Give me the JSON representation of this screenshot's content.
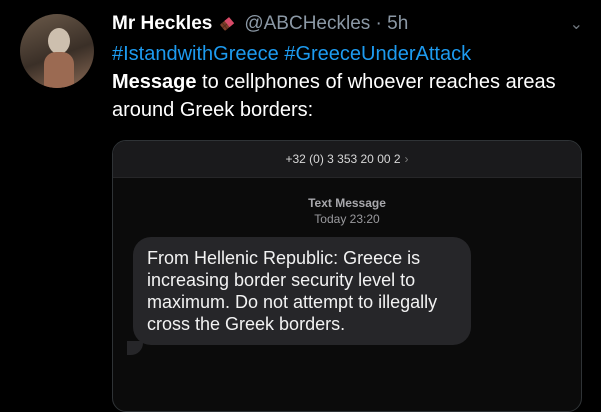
{
  "tweet": {
    "author_name": "Mr Heckles",
    "handle_and_time": "@ABCHeckles · 5h",
    "hashtag_1": "#IstandwithGreece",
    "hashtag_2": "#GreeceUnderAttack",
    "text_bold": "Message",
    "text_rest": " to cellphones of whoever reaches areas around Greek borders:"
  },
  "sms": {
    "sender_number": "+32 (0) 3 353 20 00 2",
    "label": "Text Message",
    "timestamp": "Today 23:20",
    "message": "From Hellenic Republic: Greece is increasing border security level to maximum. Do not attempt to illegally cross the Greek borders."
  },
  "icons": {
    "badge": "chocolate-bar-icon",
    "more": "chevron-down-icon",
    "sender_arrow": "chevron-right-icon"
  }
}
